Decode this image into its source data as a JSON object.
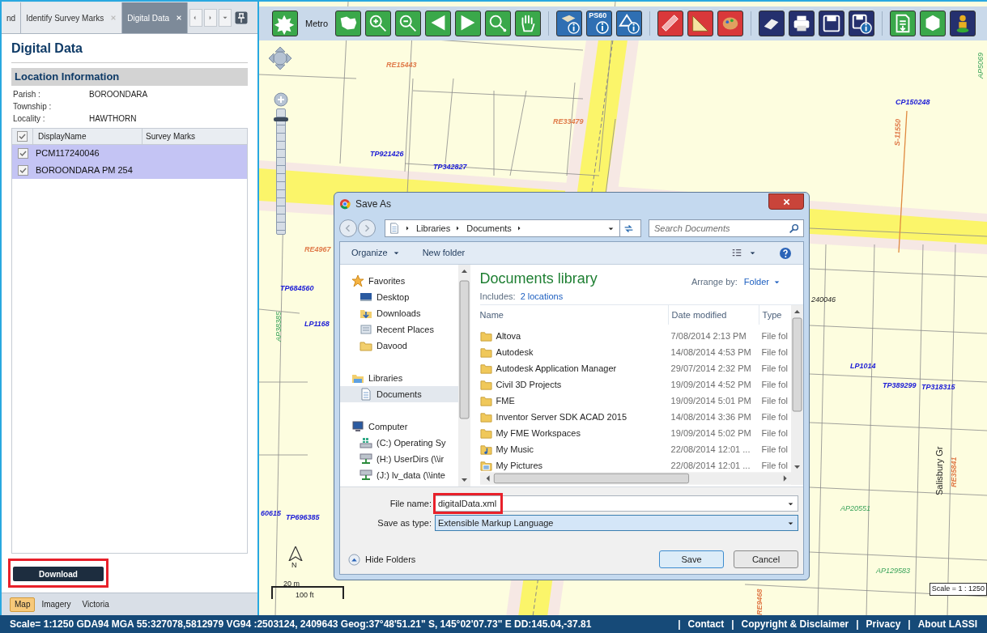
{
  "side_panel": {
    "tabs": [
      {
        "label": "nd",
        "selected": false,
        "closable": false
      },
      {
        "label": "Identify Survey Marks",
        "selected": false,
        "closable": true
      },
      {
        "label": "Digital Data",
        "selected": true,
        "closable": true
      }
    ],
    "title": "Digital Data",
    "section_title": "Location Information",
    "fields": [
      {
        "label": "Parish :",
        "value": "BOROONDARA"
      },
      {
        "label": "Township :"
      },
      {
        "label": "Locality :",
        "value": "HAWTHORN"
      }
    ],
    "grid": {
      "columns": [
        "DisplayName",
        "Survey Marks"
      ],
      "header_checked": true,
      "rows": [
        {
          "name": "PCM117240046",
          "checked": true,
          "selected": true
        },
        {
          "name": "BOROONDARA PM 254",
          "checked": true,
          "selected": true
        }
      ]
    },
    "download_button": "Download",
    "view_tabs": [
      {
        "label": "Map",
        "selected": true
      },
      {
        "label": "Imagery",
        "selected": false
      },
      {
        "label": "Victoria",
        "selected": false
      }
    ]
  },
  "toolbar": {
    "metro_label": "Metro",
    "info_badge": "PS60"
  },
  "map": {
    "labels": [
      {
        "text": "RE15443",
        "kind": "reserve"
      },
      {
        "text": "TP921426",
        "kind": "parcel"
      },
      {
        "text": "TP342827",
        "kind": "parcel"
      },
      {
        "text": "RE33479",
        "kind": "reserve"
      },
      {
        "text": "CP150248",
        "kind": "parcel"
      },
      {
        "text": "S-11550",
        "kind": "road"
      },
      {
        "text": "AP5069",
        "kind": "plan"
      },
      {
        "text": "RE4967",
        "kind": "reserve"
      },
      {
        "text": "TP684560",
        "kind": "parcel"
      },
      {
        "text": "LP1168",
        "kind": "parcel"
      },
      {
        "text": "AP38385",
        "kind": "plan"
      },
      {
        "text": "LP1014",
        "kind": "parcel"
      },
      {
        "text": "TP389299",
        "kind": "parcel"
      },
      {
        "text": "TP318315",
        "kind": "parcel"
      },
      {
        "text": "240046",
        "kind": "mark"
      },
      {
        "text": "AP20551",
        "kind": "plan"
      },
      {
        "text": "AP129583",
        "kind": "plan"
      },
      {
        "text": "RE35841",
        "kind": "road"
      },
      {
        "text": "Salisbury Gr",
        "kind": "street"
      },
      {
        "text": "60615",
        "kind": "parcel"
      },
      {
        "text": "TP696385",
        "kind": "parcel"
      },
      {
        "text": "RE9468",
        "kind": "road"
      }
    ],
    "zoom": {
      "level": 0.93
    },
    "north_label": "N",
    "scale_bar": {
      "metric": "20 m",
      "imperial": "100 ft"
    },
    "scale_label": "Scale = 1 : 1250"
  },
  "dialog": {
    "title": "Save As",
    "breadcrumb": [
      "Libraries",
      "Documents"
    ],
    "search_placeholder": "Search Documents",
    "commands": [
      "Organize",
      "New folder"
    ],
    "nav": [
      {
        "label": "Favorites",
        "kind": "favorites",
        "selected": false,
        "children": [
          {
            "label": "Desktop",
            "kind": "desktop",
            "selected": false
          },
          {
            "label": "Downloads",
            "kind": "downloads",
            "selected": false
          },
          {
            "label": "Recent Places",
            "kind": "recent",
            "selected": false
          },
          {
            "label": "Davood",
            "kind": "folder",
            "selected": false
          }
        ]
      },
      {
        "label": "Libraries",
        "kind": "libraries",
        "selected": false,
        "children": [
          {
            "label": "Documents",
            "kind": "documents",
            "selected": true
          }
        ]
      },
      {
        "label": "Computer",
        "kind": "computer",
        "selected": false,
        "children": [
          {
            "label": "(C:) Operating Sy",
            "kind": "system-drive",
            "selected": false
          },
          {
            "label": "(H:) UserDirs (\\\\ir",
            "kind": "network-drive",
            "selected": false
          },
          {
            "label": "(J:) lv_data (\\\\inte",
            "kind": "network-drive",
            "selected": false
          }
        ]
      }
    ],
    "library_title": "Documents library",
    "includes_label": "Includes:",
    "includes_link": "2 locations",
    "arrange_label": "Arrange by:",
    "arrange_value": "Folder",
    "columns": [
      "Name",
      "Date modified",
      "Type"
    ],
    "files": [
      {
        "name": "Altova",
        "date": "7/08/2014 2:13 PM",
        "type": "File fol",
        "kind": "folder"
      },
      {
        "name": "Autodesk",
        "date": "14/08/2014 4:53 PM",
        "type": "File fol",
        "kind": "folder"
      },
      {
        "name": "Autodesk Application Manager",
        "date": "29/07/2014 2:32 PM",
        "type": "File fol",
        "kind": "folder"
      },
      {
        "name": "Civil 3D Projects",
        "date": "19/09/2014 4:52 PM",
        "type": "File fol",
        "kind": "folder"
      },
      {
        "name": "FME",
        "date": "19/09/2014 5:01 PM",
        "type": "File fol",
        "kind": "folder"
      },
      {
        "name": "Inventor Server SDK ACAD 2015",
        "date": "14/08/2014 3:36 PM",
        "type": "File fol",
        "kind": "folder"
      },
      {
        "name": "My FME Workspaces",
        "date": "19/09/2014 5:02 PM",
        "type": "File fol",
        "kind": "folder"
      },
      {
        "name": "My Music",
        "date": "22/08/2014 12:01 ...",
        "type": "File fol",
        "kind": "music"
      },
      {
        "name": "My Pictures",
        "date": "22/08/2014 12:01 ...",
        "type": "File fol",
        "kind": "pictures"
      }
    ],
    "file_name_label": "File name:",
    "file_name": "digitalData.xml",
    "save_type_label": "Save as type:",
    "save_type": "Extensible Markup Language",
    "hide_folders": "Hide Folders",
    "buttons": [
      "Save",
      "Cancel"
    ]
  },
  "status_bar": {
    "text": "Scale= 1:1250 GDA94 MGA 55:327078,5812979 VG94 :2503124, 2409643 Geog:37°48'51.21\" S, 145°02'07.73\" E DD:145.04,-37.81",
    "separator": "|",
    "links": [
      "Contact",
      "Copyright & Disclaimer",
      "Privacy",
      "About LASSI"
    ]
  }
}
